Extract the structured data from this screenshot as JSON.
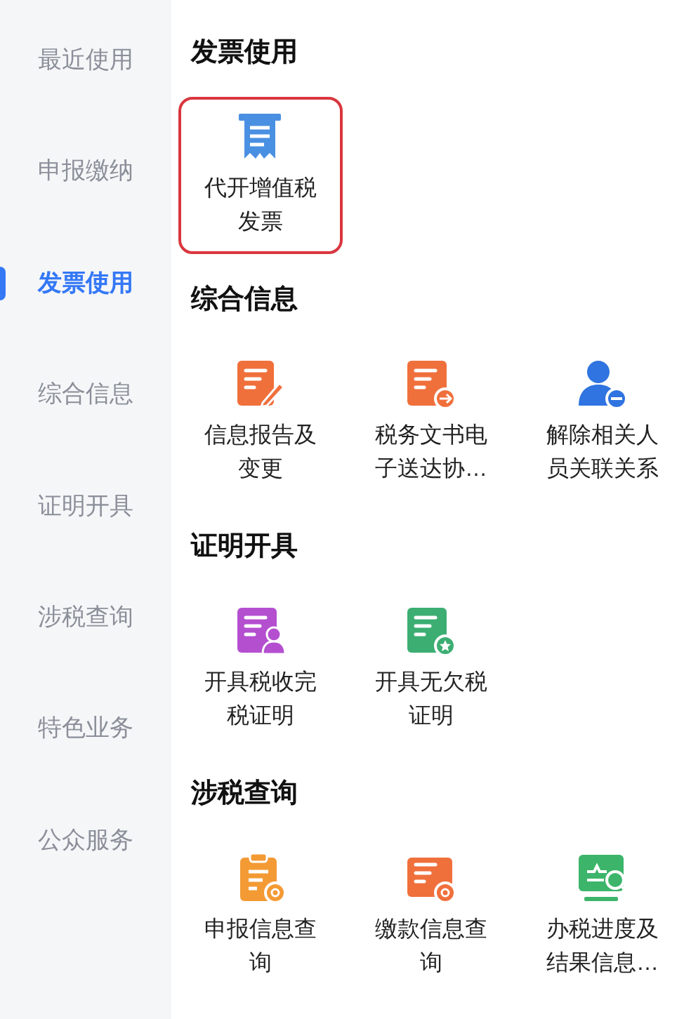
{
  "sidebar": {
    "items": [
      {
        "label": "最近使用",
        "selected": false
      },
      {
        "label": "申报缴纳",
        "selected": false
      },
      {
        "label": "发票使用",
        "selected": true
      },
      {
        "label": "综合信息",
        "selected": false
      },
      {
        "label": "证明开具",
        "selected": false
      },
      {
        "label": "涉税查询",
        "selected": false
      },
      {
        "label": "特色业务",
        "selected": false
      },
      {
        "label": "公众服务",
        "selected": false
      }
    ]
  },
  "sections": [
    {
      "title": "发票使用",
      "items": [
        {
          "label": "代开增值税发票",
          "kind": "receipt",
          "color": "#4a90e2",
          "highlighted": true
        }
      ]
    },
    {
      "title": "综合信息",
      "items": [
        {
          "label": "信息报告及变更",
          "kind": "doc-pen",
          "color": "#f0703c",
          "highlighted": false
        },
        {
          "label": "税务文书电子送达协…",
          "kind": "doc-arrow",
          "color": "#f0703c",
          "highlighted": false
        },
        {
          "label": "解除相关人员关联关系",
          "kind": "person-minus",
          "color": "#2f74e0",
          "highlighted": false
        }
      ]
    },
    {
      "title": "证明开具",
      "items": [
        {
          "label": "开具税收完税证明",
          "kind": "doc-person",
          "color": "#b44fd0",
          "highlighted": false
        },
        {
          "label": "开具无欠税证明",
          "kind": "doc-star",
          "color": "#3cae72",
          "highlighted": false
        }
      ]
    },
    {
      "title": "涉税查询",
      "items": [
        {
          "label": "申报信息查询",
          "kind": "clipboard-search",
          "color": "#f39a34",
          "highlighted": false
        },
        {
          "label": "缴款信息查询",
          "kind": "doc-search",
          "color": "#f0703c",
          "highlighted": false
        },
        {
          "label": "办税进度及结果信息…",
          "kind": "monitor-search",
          "color": "#3cb56b",
          "highlighted": false
        }
      ]
    }
  ]
}
